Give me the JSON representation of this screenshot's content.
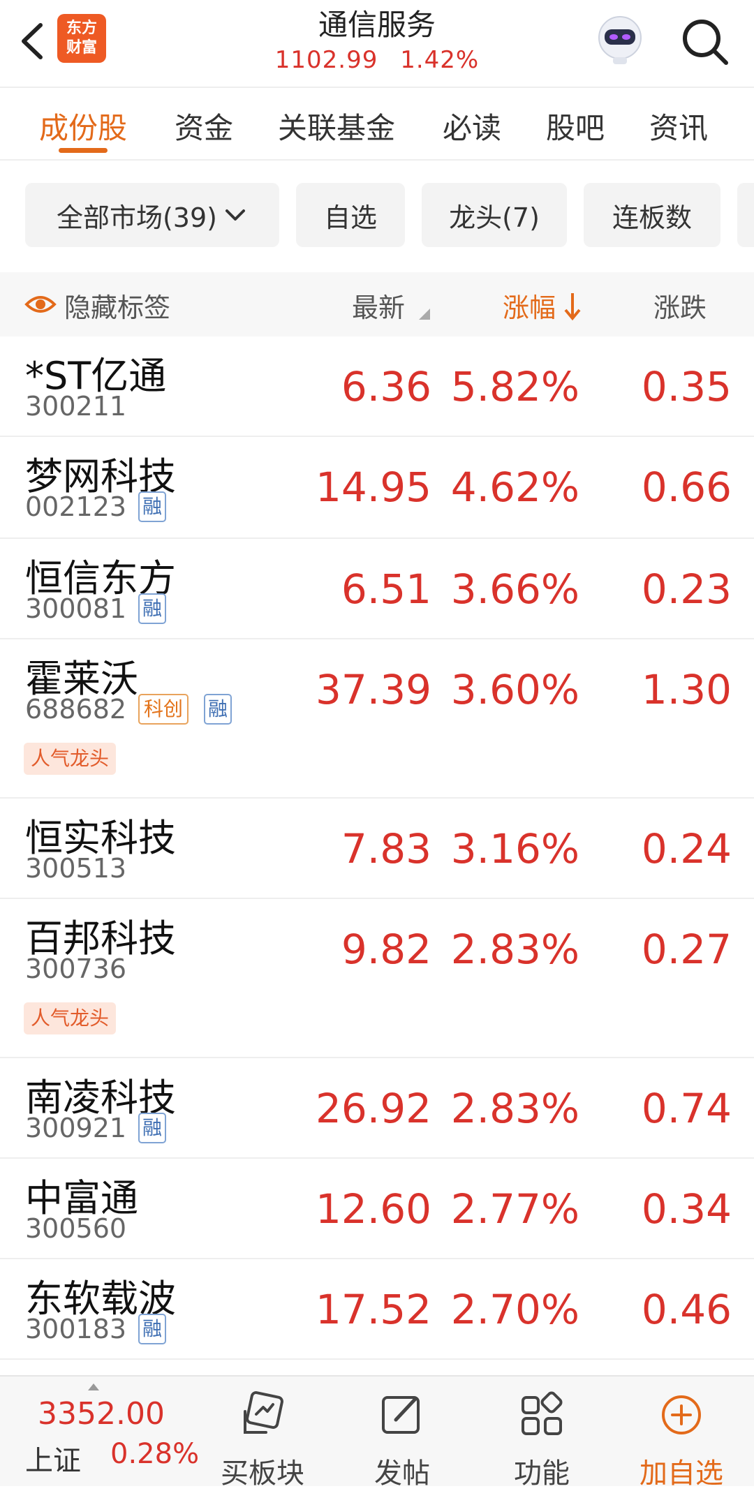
{
  "header": {
    "title": "通信服务",
    "index_value": "1102.99",
    "index_change": "1.42%",
    "logo_line1": "东方",
    "logo_line2": "财富"
  },
  "tabs": [
    "成份股",
    "资金",
    "关联基金",
    "必读",
    "股吧",
    "资讯"
  ],
  "filters": [
    "全部市场(39)",
    "自选",
    "龙头(7)",
    "连板数"
  ],
  "columns": {
    "hide_tags": "隐藏标签",
    "latest": "最新",
    "change_pct": "涨幅",
    "change": "涨跌"
  },
  "stocks": [
    {
      "name": "*ST亿通",
      "code": "300211",
      "price": "6.36",
      "pct": "5.82%",
      "chg": "0.35"
    },
    {
      "name": "梦网科技",
      "code": "002123",
      "price": "14.95",
      "pct": "4.62%",
      "chg": "0.66",
      "rong": "融"
    },
    {
      "name": "恒信东方",
      "code": "300081",
      "price": "6.51",
      "pct": "3.66%",
      "chg": "0.23",
      "rong": "融"
    },
    {
      "name": "霍莱沃",
      "code": "688682",
      "price": "37.39",
      "pct": "3.60%",
      "chg": "1.30",
      "kechuang": "科创",
      "rong": "融",
      "hot": "人气龙头"
    },
    {
      "name": "恒实科技",
      "code": "300513",
      "price": "7.83",
      "pct": "3.16%",
      "chg": "0.24"
    },
    {
      "name": "百邦科技",
      "code": "300736",
      "price": "9.82",
      "pct": "2.83%",
      "chg": "0.27",
      "hot": "人气龙头"
    },
    {
      "name": "南凌科技",
      "code": "300921",
      "price": "26.92",
      "pct": "2.83%",
      "chg": "0.74",
      "rong": "融"
    },
    {
      "name": "中富通",
      "code": "300560",
      "price": "12.60",
      "pct": "2.77%",
      "chg": "0.34"
    },
    {
      "name": "东软载波",
      "code": "300183",
      "price": "17.52",
      "pct": "2.70%",
      "chg": "0.46",
      "rong": "融"
    }
  ],
  "bottom": {
    "index_value": "3352.00",
    "index_name": "上证",
    "index_pct": "0.28%",
    "buy_sector": "买板块",
    "post": "发帖",
    "functions": "功能",
    "add_watch": "加自选"
  },
  "colors": {
    "accent": "#e36a1a",
    "up_red": "#d9322b",
    "brand": "#ee5a24"
  }
}
